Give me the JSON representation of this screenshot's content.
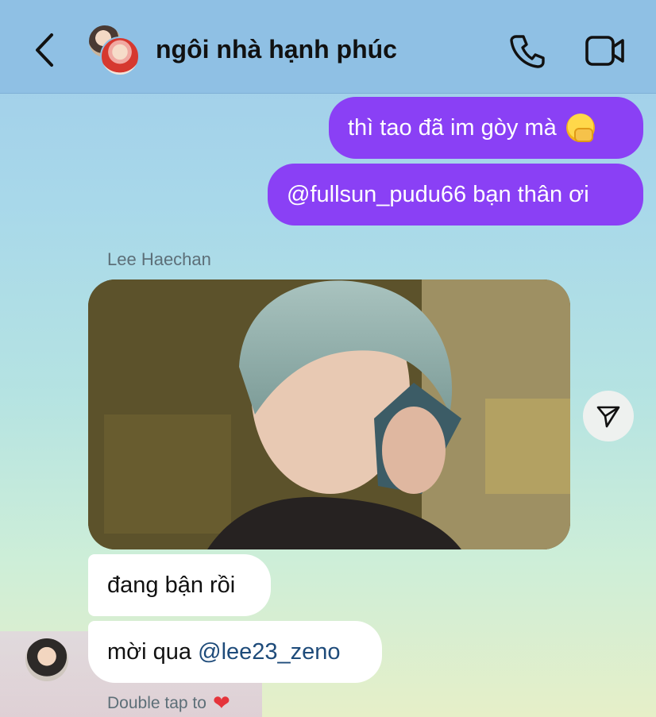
{
  "header": {
    "title": "ngôi nhà hạnh phúc"
  },
  "messages": {
    "out1": "thì tao đã im gòy mà",
    "out2_mention": "@fullsun_pudu66",
    "out2_text": " bạn thân ơi",
    "sender": "Lee Haechan",
    "in1": "đang bận rồi",
    "in2_text": "mời qua ",
    "in2_mention": "@lee23_zeno"
  },
  "hint": {
    "text": "Double tap to"
  },
  "colors": {
    "outgoing_bubble": "#8a40f5",
    "header_bg": "#8fc0e4",
    "mention": "#1e4b7a",
    "heart": "#e5343b"
  },
  "icons": {
    "back": "chevron-left-icon",
    "call": "phone-icon",
    "video": "video-camera-icon",
    "share": "paper-plane-icon",
    "heart": "heart-icon"
  }
}
